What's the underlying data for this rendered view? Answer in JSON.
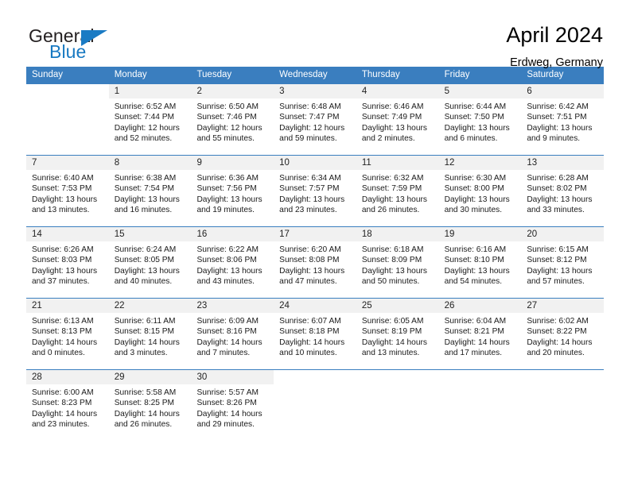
{
  "brand": {
    "name_part1": "General",
    "name_part2": "Blue",
    "triangle_color": "#1a7bc4",
    "text_color": "#231f20"
  },
  "header": {
    "title": "April 2024",
    "subtitle": "Erdweg, Germany"
  },
  "theme": {
    "header_blue": "#3a7ebf",
    "daynum_band": "#f1f1f1",
    "text": "#1a1a1a"
  },
  "weekdays": [
    "Sunday",
    "Monday",
    "Tuesday",
    "Wednesday",
    "Thursday",
    "Friday",
    "Saturday"
  ],
  "weeks": [
    [
      {
        "day": "",
        "sunrise": "",
        "sunset": "",
        "daylight1": "",
        "daylight2": ""
      },
      {
        "day": "1",
        "sunrise": "Sunrise: 6:52 AM",
        "sunset": "Sunset: 7:44 PM",
        "daylight1": "Daylight: 12 hours",
        "daylight2": "and 52 minutes."
      },
      {
        "day": "2",
        "sunrise": "Sunrise: 6:50 AM",
        "sunset": "Sunset: 7:46 PM",
        "daylight1": "Daylight: 12 hours",
        "daylight2": "and 55 minutes."
      },
      {
        "day": "3",
        "sunrise": "Sunrise: 6:48 AM",
        "sunset": "Sunset: 7:47 PM",
        "daylight1": "Daylight: 12 hours",
        "daylight2": "and 59 minutes."
      },
      {
        "day": "4",
        "sunrise": "Sunrise: 6:46 AM",
        "sunset": "Sunset: 7:49 PM",
        "daylight1": "Daylight: 13 hours",
        "daylight2": "and 2 minutes."
      },
      {
        "day": "5",
        "sunrise": "Sunrise: 6:44 AM",
        "sunset": "Sunset: 7:50 PM",
        "daylight1": "Daylight: 13 hours",
        "daylight2": "and 6 minutes."
      },
      {
        "day": "6",
        "sunrise": "Sunrise: 6:42 AM",
        "sunset": "Sunset: 7:51 PM",
        "daylight1": "Daylight: 13 hours",
        "daylight2": "and 9 minutes."
      }
    ],
    [
      {
        "day": "7",
        "sunrise": "Sunrise: 6:40 AM",
        "sunset": "Sunset: 7:53 PM",
        "daylight1": "Daylight: 13 hours",
        "daylight2": "and 13 minutes."
      },
      {
        "day": "8",
        "sunrise": "Sunrise: 6:38 AM",
        "sunset": "Sunset: 7:54 PM",
        "daylight1": "Daylight: 13 hours",
        "daylight2": "and 16 minutes."
      },
      {
        "day": "9",
        "sunrise": "Sunrise: 6:36 AM",
        "sunset": "Sunset: 7:56 PM",
        "daylight1": "Daylight: 13 hours",
        "daylight2": "and 19 minutes."
      },
      {
        "day": "10",
        "sunrise": "Sunrise: 6:34 AM",
        "sunset": "Sunset: 7:57 PM",
        "daylight1": "Daylight: 13 hours",
        "daylight2": "and 23 minutes."
      },
      {
        "day": "11",
        "sunrise": "Sunrise: 6:32 AM",
        "sunset": "Sunset: 7:59 PM",
        "daylight1": "Daylight: 13 hours",
        "daylight2": "and 26 minutes."
      },
      {
        "day": "12",
        "sunrise": "Sunrise: 6:30 AM",
        "sunset": "Sunset: 8:00 PM",
        "daylight1": "Daylight: 13 hours",
        "daylight2": "and 30 minutes."
      },
      {
        "day": "13",
        "sunrise": "Sunrise: 6:28 AM",
        "sunset": "Sunset: 8:02 PM",
        "daylight1": "Daylight: 13 hours",
        "daylight2": "and 33 minutes."
      }
    ],
    [
      {
        "day": "14",
        "sunrise": "Sunrise: 6:26 AM",
        "sunset": "Sunset: 8:03 PM",
        "daylight1": "Daylight: 13 hours",
        "daylight2": "and 37 minutes."
      },
      {
        "day": "15",
        "sunrise": "Sunrise: 6:24 AM",
        "sunset": "Sunset: 8:05 PM",
        "daylight1": "Daylight: 13 hours",
        "daylight2": "and 40 minutes."
      },
      {
        "day": "16",
        "sunrise": "Sunrise: 6:22 AM",
        "sunset": "Sunset: 8:06 PM",
        "daylight1": "Daylight: 13 hours",
        "daylight2": "and 43 minutes."
      },
      {
        "day": "17",
        "sunrise": "Sunrise: 6:20 AM",
        "sunset": "Sunset: 8:08 PM",
        "daylight1": "Daylight: 13 hours",
        "daylight2": "and 47 minutes."
      },
      {
        "day": "18",
        "sunrise": "Sunrise: 6:18 AM",
        "sunset": "Sunset: 8:09 PM",
        "daylight1": "Daylight: 13 hours",
        "daylight2": "and 50 minutes."
      },
      {
        "day": "19",
        "sunrise": "Sunrise: 6:16 AM",
        "sunset": "Sunset: 8:10 PM",
        "daylight1": "Daylight: 13 hours",
        "daylight2": "and 54 minutes."
      },
      {
        "day": "20",
        "sunrise": "Sunrise: 6:15 AM",
        "sunset": "Sunset: 8:12 PM",
        "daylight1": "Daylight: 13 hours",
        "daylight2": "and 57 minutes."
      }
    ],
    [
      {
        "day": "21",
        "sunrise": "Sunrise: 6:13 AM",
        "sunset": "Sunset: 8:13 PM",
        "daylight1": "Daylight: 14 hours",
        "daylight2": "and 0 minutes."
      },
      {
        "day": "22",
        "sunrise": "Sunrise: 6:11 AM",
        "sunset": "Sunset: 8:15 PM",
        "daylight1": "Daylight: 14 hours",
        "daylight2": "and 3 minutes."
      },
      {
        "day": "23",
        "sunrise": "Sunrise: 6:09 AM",
        "sunset": "Sunset: 8:16 PM",
        "daylight1": "Daylight: 14 hours",
        "daylight2": "and 7 minutes."
      },
      {
        "day": "24",
        "sunrise": "Sunrise: 6:07 AM",
        "sunset": "Sunset: 8:18 PM",
        "daylight1": "Daylight: 14 hours",
        "daylight2": "and 10 minutes."
      },
      {
        "day": "25",
        "sunrise": "Sunrise: 6:05 AM",
        "sunset": "Sunset: 8:19 PM",
        "daylight1": "Daylight: 14 hours",
        "daylight2": "and 13 minutes."
      },
      {
        "day": "26",
        "sunrise": "Sunrise: 6:04 AM",
        "sunset": "Sunset: 8:21 PM",
        "daylight1": "Daylight: 14 hours",
        "daylight2": "and 17 minutes."
      },
      {
        "day": "27",
        "sunrise": "Sunrise: 6:02 AM",
        "sunset": "Sunset: 8:22 PM",
        "daylight1": "Daylight: 14 hours",
        "daylight2": "and 20 minutes."
      }
    ],
    [
      {
        "day": "28",
        "sunrise": "Sunrise: 6:00 AM",
        "sunset": "Sunset: 8:23 PM",
        "daylight1": "Daylight: 14 hours",
        "daylight2": "and 23 minutes."
      },
      {
        "day": "29",
        "sunrise": "Sunrise: 5:58 AM",
        "sunset": "Sunset: 8:25 PM",
        "daylight1": "Daylight: 14 hours",
        "daylight2": "and 26 minutes."
      },
      {
        "day": "30",
        "sunrise": "Sunrise: 5:57 AM",
        "sunset": "Sunset: 8:26 PM",
        "daylight1": "Daylight: 14 hours",
        "daylight2": "and 29 minutes."
      },
      {
        "day": "",
        "sunrise": "",
        "sunset": "",
        "daylight1": "",
        "daylight2": ""
      },
      {
        "day": "",
        "sunrise": "",
        "sunset": "",
        "daylight1": "",
        "daylight2": ""
      },
      {
        "day": "",
        "sunrise": "",
        "sunset": "",
        "daylight1": "",
        "daylight2": ""
      },
      {
        "day": "",
        "sunrise": "",
        "sunset": "",
        "daylight1": "",
        "daylight2": ""
      }
    ]
  ]
}
